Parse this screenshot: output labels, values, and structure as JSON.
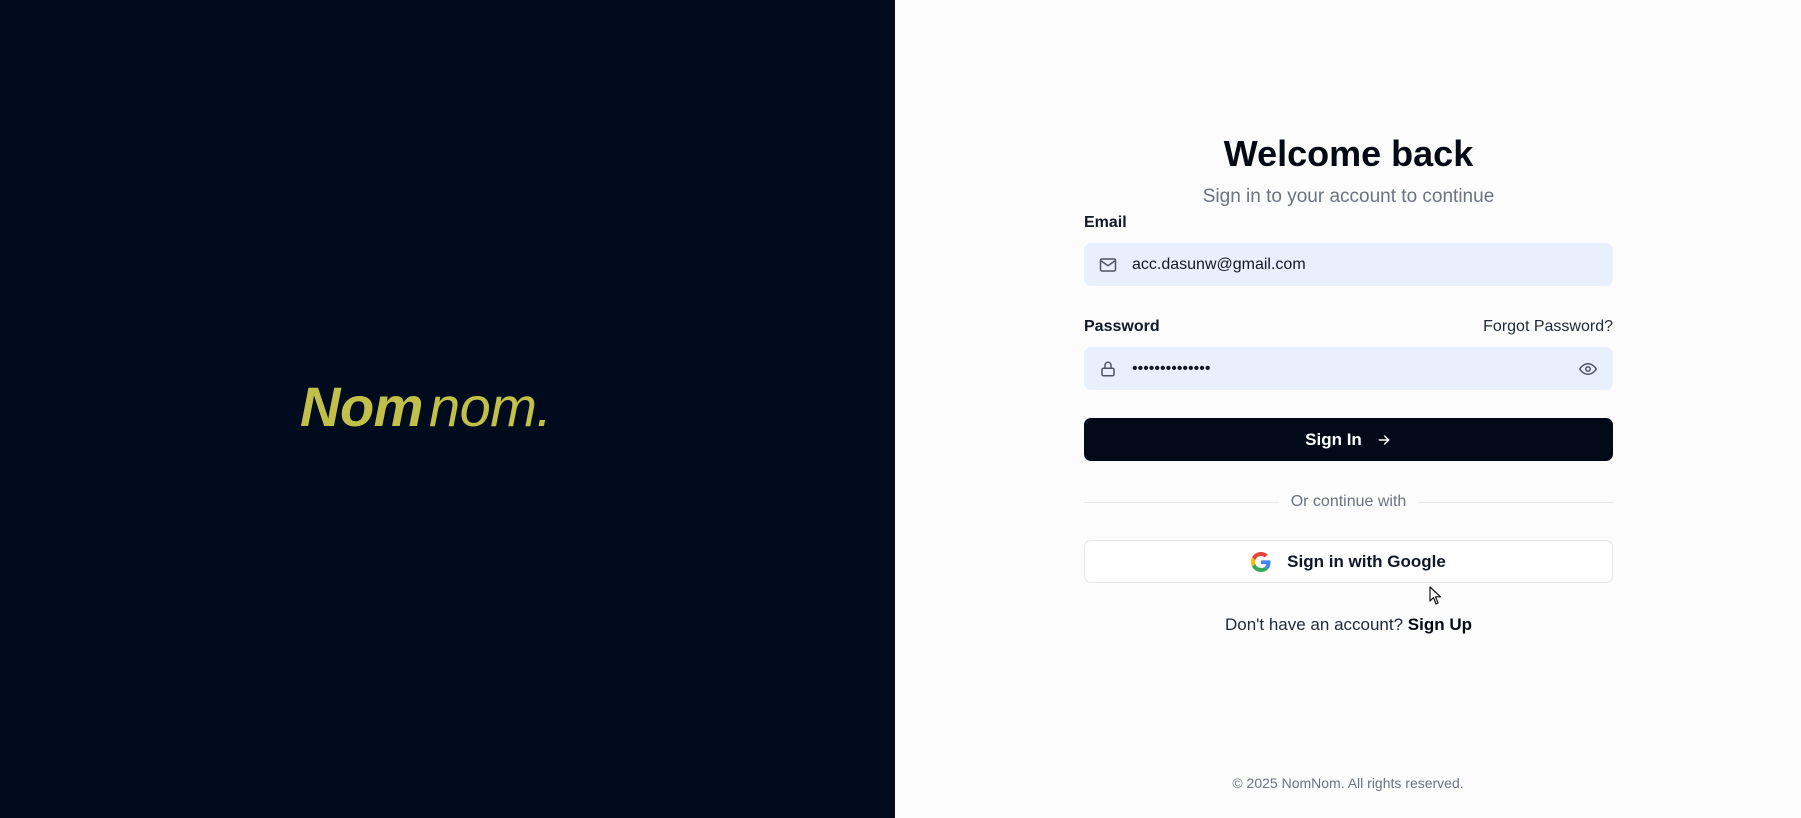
{
  "brand": {
    "logo_bold": "Nom",
    "logo_light": "nom.",
    "logo_color": "#c3c049",
    "background": "#010b1e"
  },
  "form": {
    "title": "Welcome back",
    "subtitle": "Sign in to your account to continue",
    "email_label": "Email",
    "email_value": "acc.dasunw@gmail.com",
    "email_icon": "mail-icon",
    "password_label": "Password",
    "forgot_link": "Forgot Password?",
    "password_value": "••••••••••••••",
    "password_icon": "lock-icon",
    "toggle_icon": "eye-icon",
    "signin_label": "Sign In",
    "signin_icon": "arrow-right-icon",
    "divider_text": "Or continue with",
    "google_label": "Sign in with Google",
    "google_icon": "google-icon",
    "signup_prompt": "Don't have an account?",
    "signup_link": "Sign Up",
    "field_bg": "#e8f0fe",
    "button_bg": "#020a1a"
  },
  "footer": {
    "text": "© 2025 NomNom. All rights reserved."
  }
}
